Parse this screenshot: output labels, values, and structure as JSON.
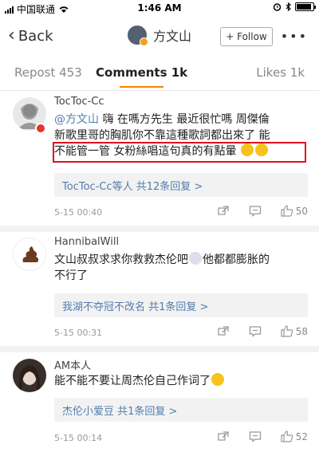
{
  "status_bar": {
    "carrier": "中国联通",
    "time": "1:46 AM"
  },
  "nav": {
    "back_label": "Back",
    "title": "方文山",
    "follow_label": "+ Follow",
    "more_label": "•••"
  },
  "tabs": [
    {
      "label": "Repost 453"
    },
    {
      "label": "Comments 1k"
    },
    {
      "label": "Likes 1k"
    }
  ],
  "comments": [
    {
      "user": "TocToc-Cc",
      "mention": "@方文山",
      "text_line1": " 嗨 在嗎方先生 最近很忙嗎 周傑倫",
      "text_line2": "新歌里哥的胸肌你不靠這種歌詞都出來了 能",
      "text_line3": "不能管一管 女粉絲唱這句真的有點暈",
      "reply": "TocToc-Cc等人 共12条回复 >",
      "date": "5-15 00:40",
      "likes": "50"
    },
    {
      "user": "HannibalWill",
      "text_line1": "文山叔叔求求你救救杰伦吧",
      "text_line1b": "他都都膨胀的",
      "text_line2": "不行了",
      "reply": "我湖不夺冠不改名 共1条回复 >",
      "date": "5-15 00:31",
      "likes": "58"
    },
    {
      "user": "AM本人",
      "text_line1": "能不能不要让周杰伦自己作词了",
      "reply": "杰伦小爱豆 共1条回复 >",
      "date": "5-15 00:14",
      "likes": "52"
    }
  ],
  "colors": {
    "accent": "#ff8200",
    "link": "#507daf",
    "highlight": "#e0101a"
  }
}
